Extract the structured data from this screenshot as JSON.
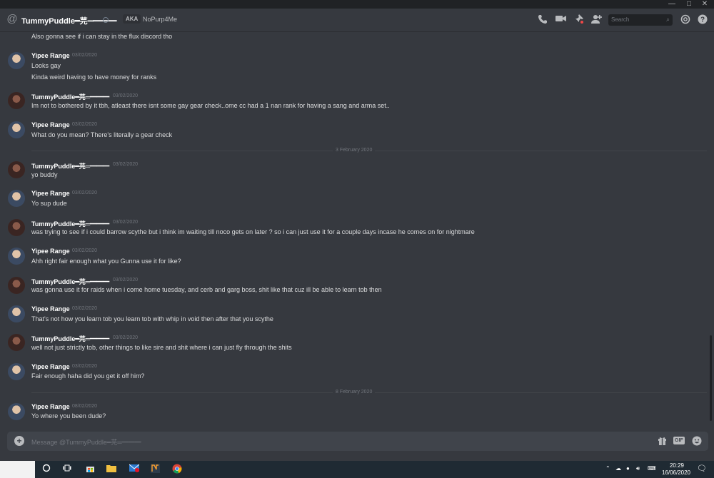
{
  "window": {
    "minimize_glyph": "—",
    "maximize_glyph": "□",
    "close_glyph": "✕"
  },
  "header": {
    "at_glyph": "@",
    "username": "TummyPuddle━芫═━━━",
    "aka_label": "AKA",
    "aka_name": "NoPurp4Me",
    "search_placeholder": "Search",
    "icons": [
      "call-icon",
      "video-icon",
      "pin-icon",
      "add-friend-icon",
      "mention-icon",
      "help-icon"
    ]
  },
  "messages": {
    "m0": {
      "text": "Also gonna see if i can stay in the flux discord tho"
    },
    "m1": {
      "author": "Yipee Range",
      "timestamp": "03/02/2020",
      "lines": [
        "Looks gay",
        "Kinda weird having to have money for ranks"
      ]
    },
    "m2": {
      "author": "TummyPuddle━芫═━━━",
      "timestamp": "03/02/2020",
      "text": "Im not to bothered by it tbh, atleast there isnt some gay gear check..ome cc had a 1 nan rank for having a sang and arma set.."
    },
    "m3": {
      "author": "Yipee Range",
      "timestamp": "03/02/2020",
      "text": "What do you mean? There's literally a gear check"
    },
    "m4": {
      "author": "TummyPuddle━芫═━━━",
      "timestamp": "03/02/2020",
      "text": "yo buddy"
    },
    "m5": {
      "author": "Yipee Range",
      "timestamp": "03/02/2020",
      "text": "Yo sup dude"
    },
    "m6": {
      "author": "TummyPuddle━芫═━━━",
      "timestamp": "03/02/2020",
      "text": "was trying to see if i could barrow scythe but i think im waiting till noco gets on later ? so i can just use it for a couple days incase he comes on for nightmare"
    },
    "m7": {
      "author": "Yipee Range",
      "timestamp": "03/02/2020",
      "text": "Ahh right fair enough what you Gunna use it for like?"
    },
    "m8": {
      "author": "TummyPuddle━芫═━━━",
      "timestamp": "03/02/2020",
      "text": "was gonna use it for raids when i come home tuesday, and cerb and garg boss, shit like that cuz ill be able to learn tob then"
    },
    "m9": {
      "author": "Yipee Range",
      "timestamp": "03/02/2020",
      "text": "That's not how you learn tob you learn tob with whip in void then after that you scythe"
    },
    "m10": {
      "author": "TummyPuddle━芫═━━━",
      "timestamp": "03/02/2020",
      "text": "well not just strictly tob, other things to like sire and shit where i can just fly through the shits"
    },
    "m11": {
      "author": "Yipee Range",
      "timestamp": "03/02/2020",
      "text": "Fair enough haha did you get it off him?"
    },
    "m12": {
      "author": "Yipee Range",
      "timestamp": "08/02/2020",
      "text": "Yo where you been dude?"
    }
  },
  "dividers": {
    "d1": "3 February 2020",
    "d2": "8 February 2020"
  },
  "composer": {
    "placeholder": "Message @TummyPuddle━芫═━━━",
    "plus_glyph": "+",
    "gif_label": "GIF"
  },
  "taskbar": {
    "apps": [
      "cortana-icon",
      "task-view-icon",
      "store-icon",
      "file-explorer-icon",
      "mail-icon",
      "app-icon",
      "chrome-icon"
    ],
    "tray_time": "20:29",
    "tray_date": "16/06/2020"
  },
  "colors": {
    "background": "#36393f",
    "composer": "#40444b",
    "titlebar": "#202225",
    "taskbar": "#1f2a33"
  }
}
